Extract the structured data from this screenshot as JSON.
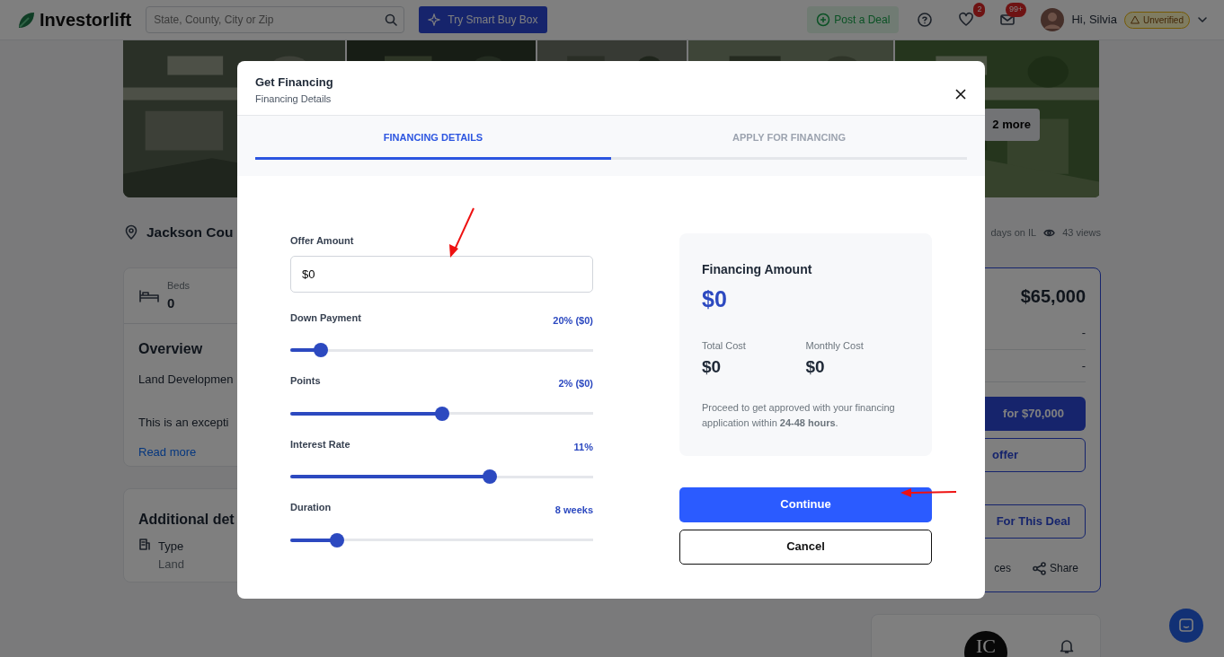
{
  "header": {
    "logo": "Investorlift",
    "search": {
      "placeholder": "State, County, City or Zip"
    },
    "smart_buy_box": "Try Smart Buy Box",
    "post_deal": "Post a Deal",
    "badges": [
      "2",
      "99+"
    ],
    "greeting": "Hi, Silvia",
    "user_status": "Unverified"
  },
  "listing": {
    "more_photos": "2 more",
    "title": "Jackson Cou",
    "stats": [
      "days on IL",
      "43 views"
    ],
    "details": {
      "beds_label": "Beds",
      "beds_value": "0",
      "overview_heading": "Overview",
      "overview_lines": [
        "Land Developmen",
        "This is an excepti"
      ],
      "read_more": "Read more"
    },
    "additional": {
      "heading": "Additional det",
      "type_label": "Type",
      "type_value": "Land"
    },
    "price_panel": {
      "price": "$65,000",
      "rows": [
        "-",
        "-"
      ],
      "buy_button": "for $70,000",
      "offer_button": "offer",
      "deal_button": "For This Deal",
      "actions": [
        "ces",
        "Share"
      ]
    },
    "agent": {
      "logo": "IC"
    }
  },
  "modal": {
    "title": "Get Financing",
    "subtitle": "Financing Details",
    "tabs": [
      {
        "label": "FINANCING DETAILS",
        "selected": true
      },
      {
        "label": "APPLY FOR FINANCING",
        "selected": false
      }
    ],
    "offer_amount": {
      "label": "Offer Amount",
      "value": "$0"
    },
    "sliders": [
      {
        "label": "Down Payment",
        "reading": "20% ($0)",
        "level": 0.1
      },
      {
        "label": "Points",
        "reading": "2% ($0)",
        "level": 0.5
      },
      {
        "label": "Interest Rate",
        "reading": "11%",
        "level": 0.66
      },
      {
        "label": "Duration",
        "reading": "8 weeks",
        "level": 0.155
      }
    ],
    "summary": {
      "title": "Financing Amount",
      "amount": "$0",
      "costs": [
        {
          "label": "Total Cost",
          "value": "$0"
        },
        {
          "label": "Monthly Cost",
          "value": "$0"
        }
      ],
      "note": "Proceed to get approved with your financing application within **24-48 hours**."
    },
    "continue": "Continue",
    "cancel": "Cancel"
  }
}
